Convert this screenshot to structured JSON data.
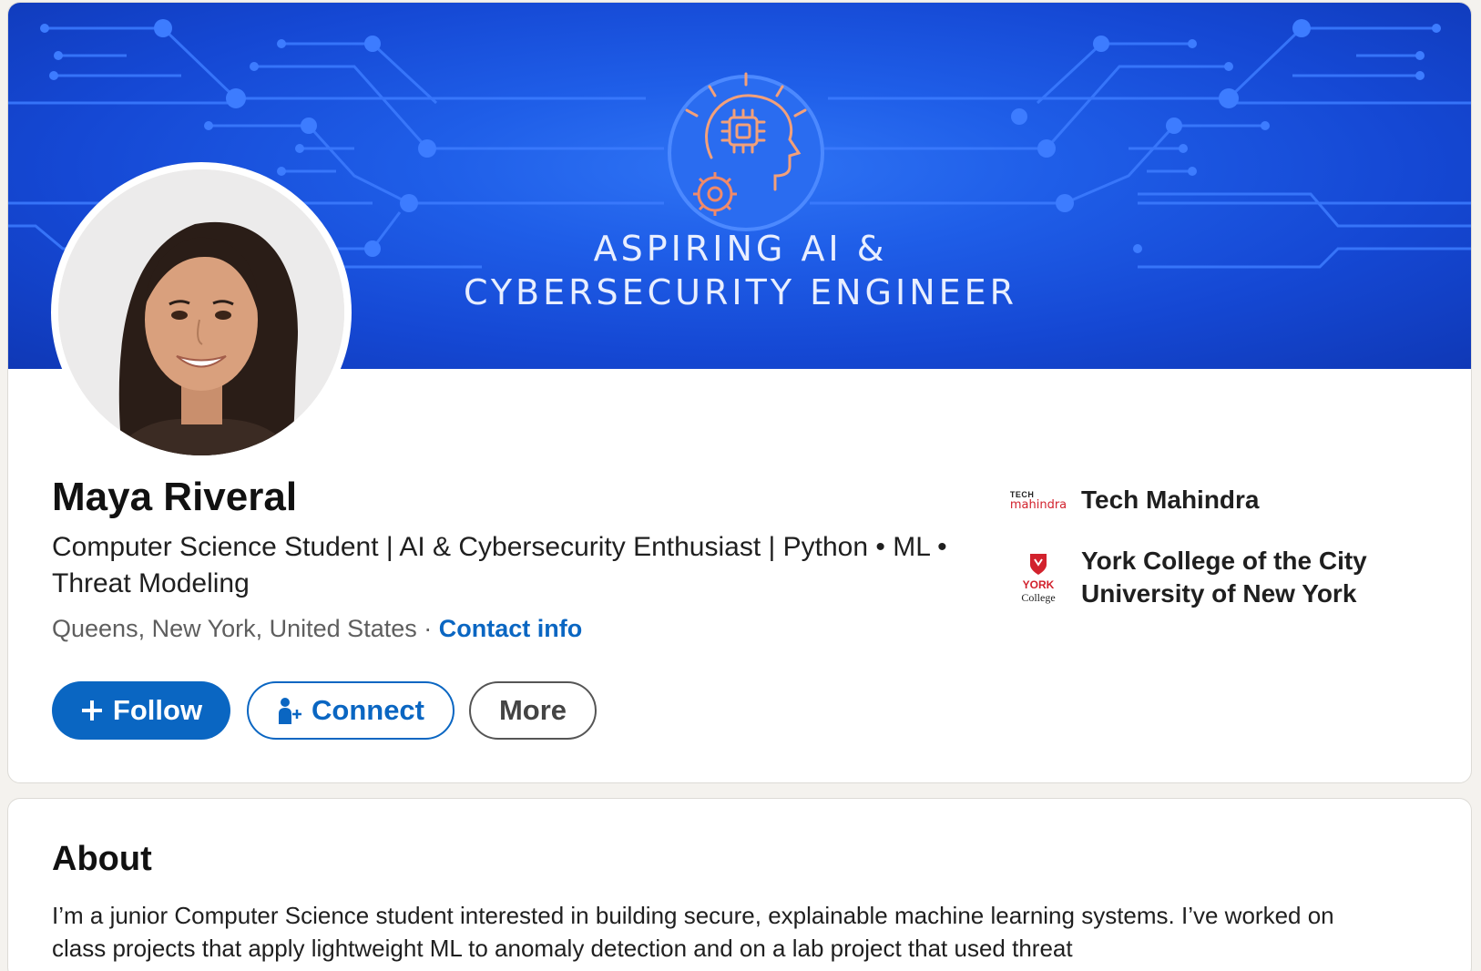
{
  "banner": {
    "line1": "ASPIRING AI &",
    "line2": "CYBERSECURITY ENGINEER",
    "bg_color": "#1f5ee8"
  },
  "profile": {
    "name": "Maya Riveral",
    "headline": "Computer Science Student | AI & Cybersecurity Enthusiast | Python • ML • Threat Modeling",
    "location": "Queens, New York, United States",
    "separator": "·",
    "contact_link": "Contact info"
  },
  "actions": {
    "follow_label": "Follow",
    "connect_label": "Connect",
    "more_label": "More"
  },
  "orgs": [
    {
      "name": "Tech Mahindra",
      "logo_top": "TECH",
      "logo_bottom": "mahindra",
      "icon": "tech-mahindra-logo"
    },
    {
      "name": "York College of the City University of New York",
      "logo_top": "YORK",
      "logo_bottom": "College",
      "icon": "york-college-logo"
    }
  ],
  "about": {
    "title": "About",
    "text": "I’m a junior Computer Science student interested in building secure, explainable machine learning systems. I’ve worked on class projects that apply lightweight ML to anomaly detection and on a lab project that used threat"
  },
  "colors": {
    "primary_blue": "#0a66c2",
    "page_bg": "#f4f2ee",
    "brand_red": "#d2222d"
  }
}
